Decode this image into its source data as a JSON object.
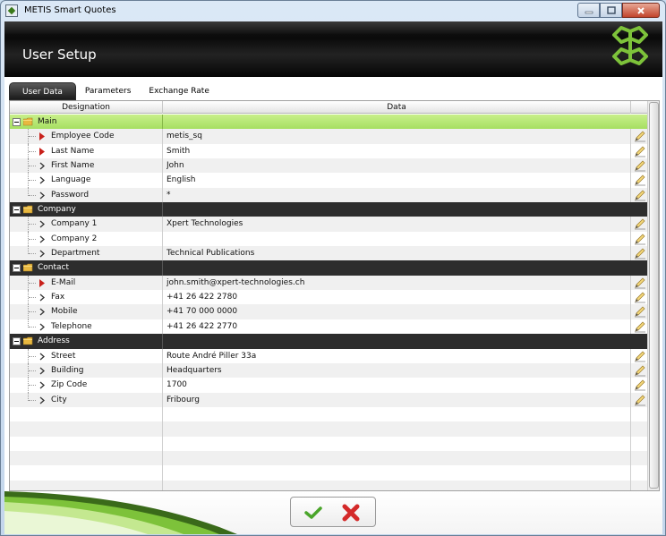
{
  "window": {
    "title": "METIS Smart Quotes"
  },
  "header": {
    "title": "User Setup"
  },
  "tabs": [
    {
      "label": "User Data",
      "active": true
    },
    {
      "label": "Parameters",
      "active": false
    },
    {
      "label": "Exchange Rate",
      "active": false
    }
  ],
  "grid": {
    "columns": {
      "designation": "Designation",
      "data": "Data"
    },
    "groups": [
      {
        "label": "Main",
        "rows": [
          {
            "label": "Employee Code",
            "value": "metis_sq",
            "required": true
          },
          {
            "label": "Last Name",
            "value": "Smith",
            "required": true
          },
          {
            "label": "First Name",
            "value": "John",
            "required": false
          },
          {
            "label": "Language",
            "value": "English",
            "required": false
          },
          {
            "label": "Password",
            "value": "*",
            "required": false
          }
        ]
      },
      {
        "label": "Company",
        "rows": [
          {
            "label": "Company 1",
            "value": "Xpert Technologies",
            "required": false
          },
          {
            "label": "Company 2",
            "value": "",
            "required": false
          },
          {
            "label": "Department",
            "value": "Technical Publications",
            "required": false
          }
        ]
      },
      {
        "label": "Contact",
        "rows": [
          {
            "label": "E-Mail",
            "value": "john.smith@xpert-technologies.ch",
            "required": true
          },
          {
            "label": "Fax",
            "value": "+41 26 422 2780",
            "required": false
          },
          {
            "label": "Mobile",
            "value": "+41 70 000 0000",
            "required": false
          },
          {
            "label": "Telephone",
            "value": "+41 26 422 2770",
            "required": false
          }
        ]
      },
      {
        "label": "Address",
        "rows": [
          {
            "label": "Street",
            "value": "Route André Piller 33a",
            "required": false
          },
          {
            "label": "Building",
            "value": "Headquarters",
            "required": false
          },
          {
            "label": "Zip Code",
            "value": "1700",
            "required": false
          },
          {
            "label": "City",
            "value": "Fribourg",
            "required": false
          }
        ]
      }
    ],
    "empty_rows": 6
  },
  "icons": {
    "expander": "collapse-minus-icon",
    "folder": "folder-icon",
    "required_arrow": "required-arrow-icon",
    "optional_arrow": "chevron-right-icon",
    "edit": "pencil-icon",
    "ok": "checkmark-icon",
    "cancel": "x-icon"
  },
  "colors": {
    "header_bg": "#111111",
    "main_group_bg": "#b4e672",
    "group_bg": "#2d2d2d",
    "required_arrow": "#c8201a",
    "ok_green": "#4aa52a",
    "cancel_red": "#d42a2a",
    "logo_green": "#7dc23a"
  }
}
